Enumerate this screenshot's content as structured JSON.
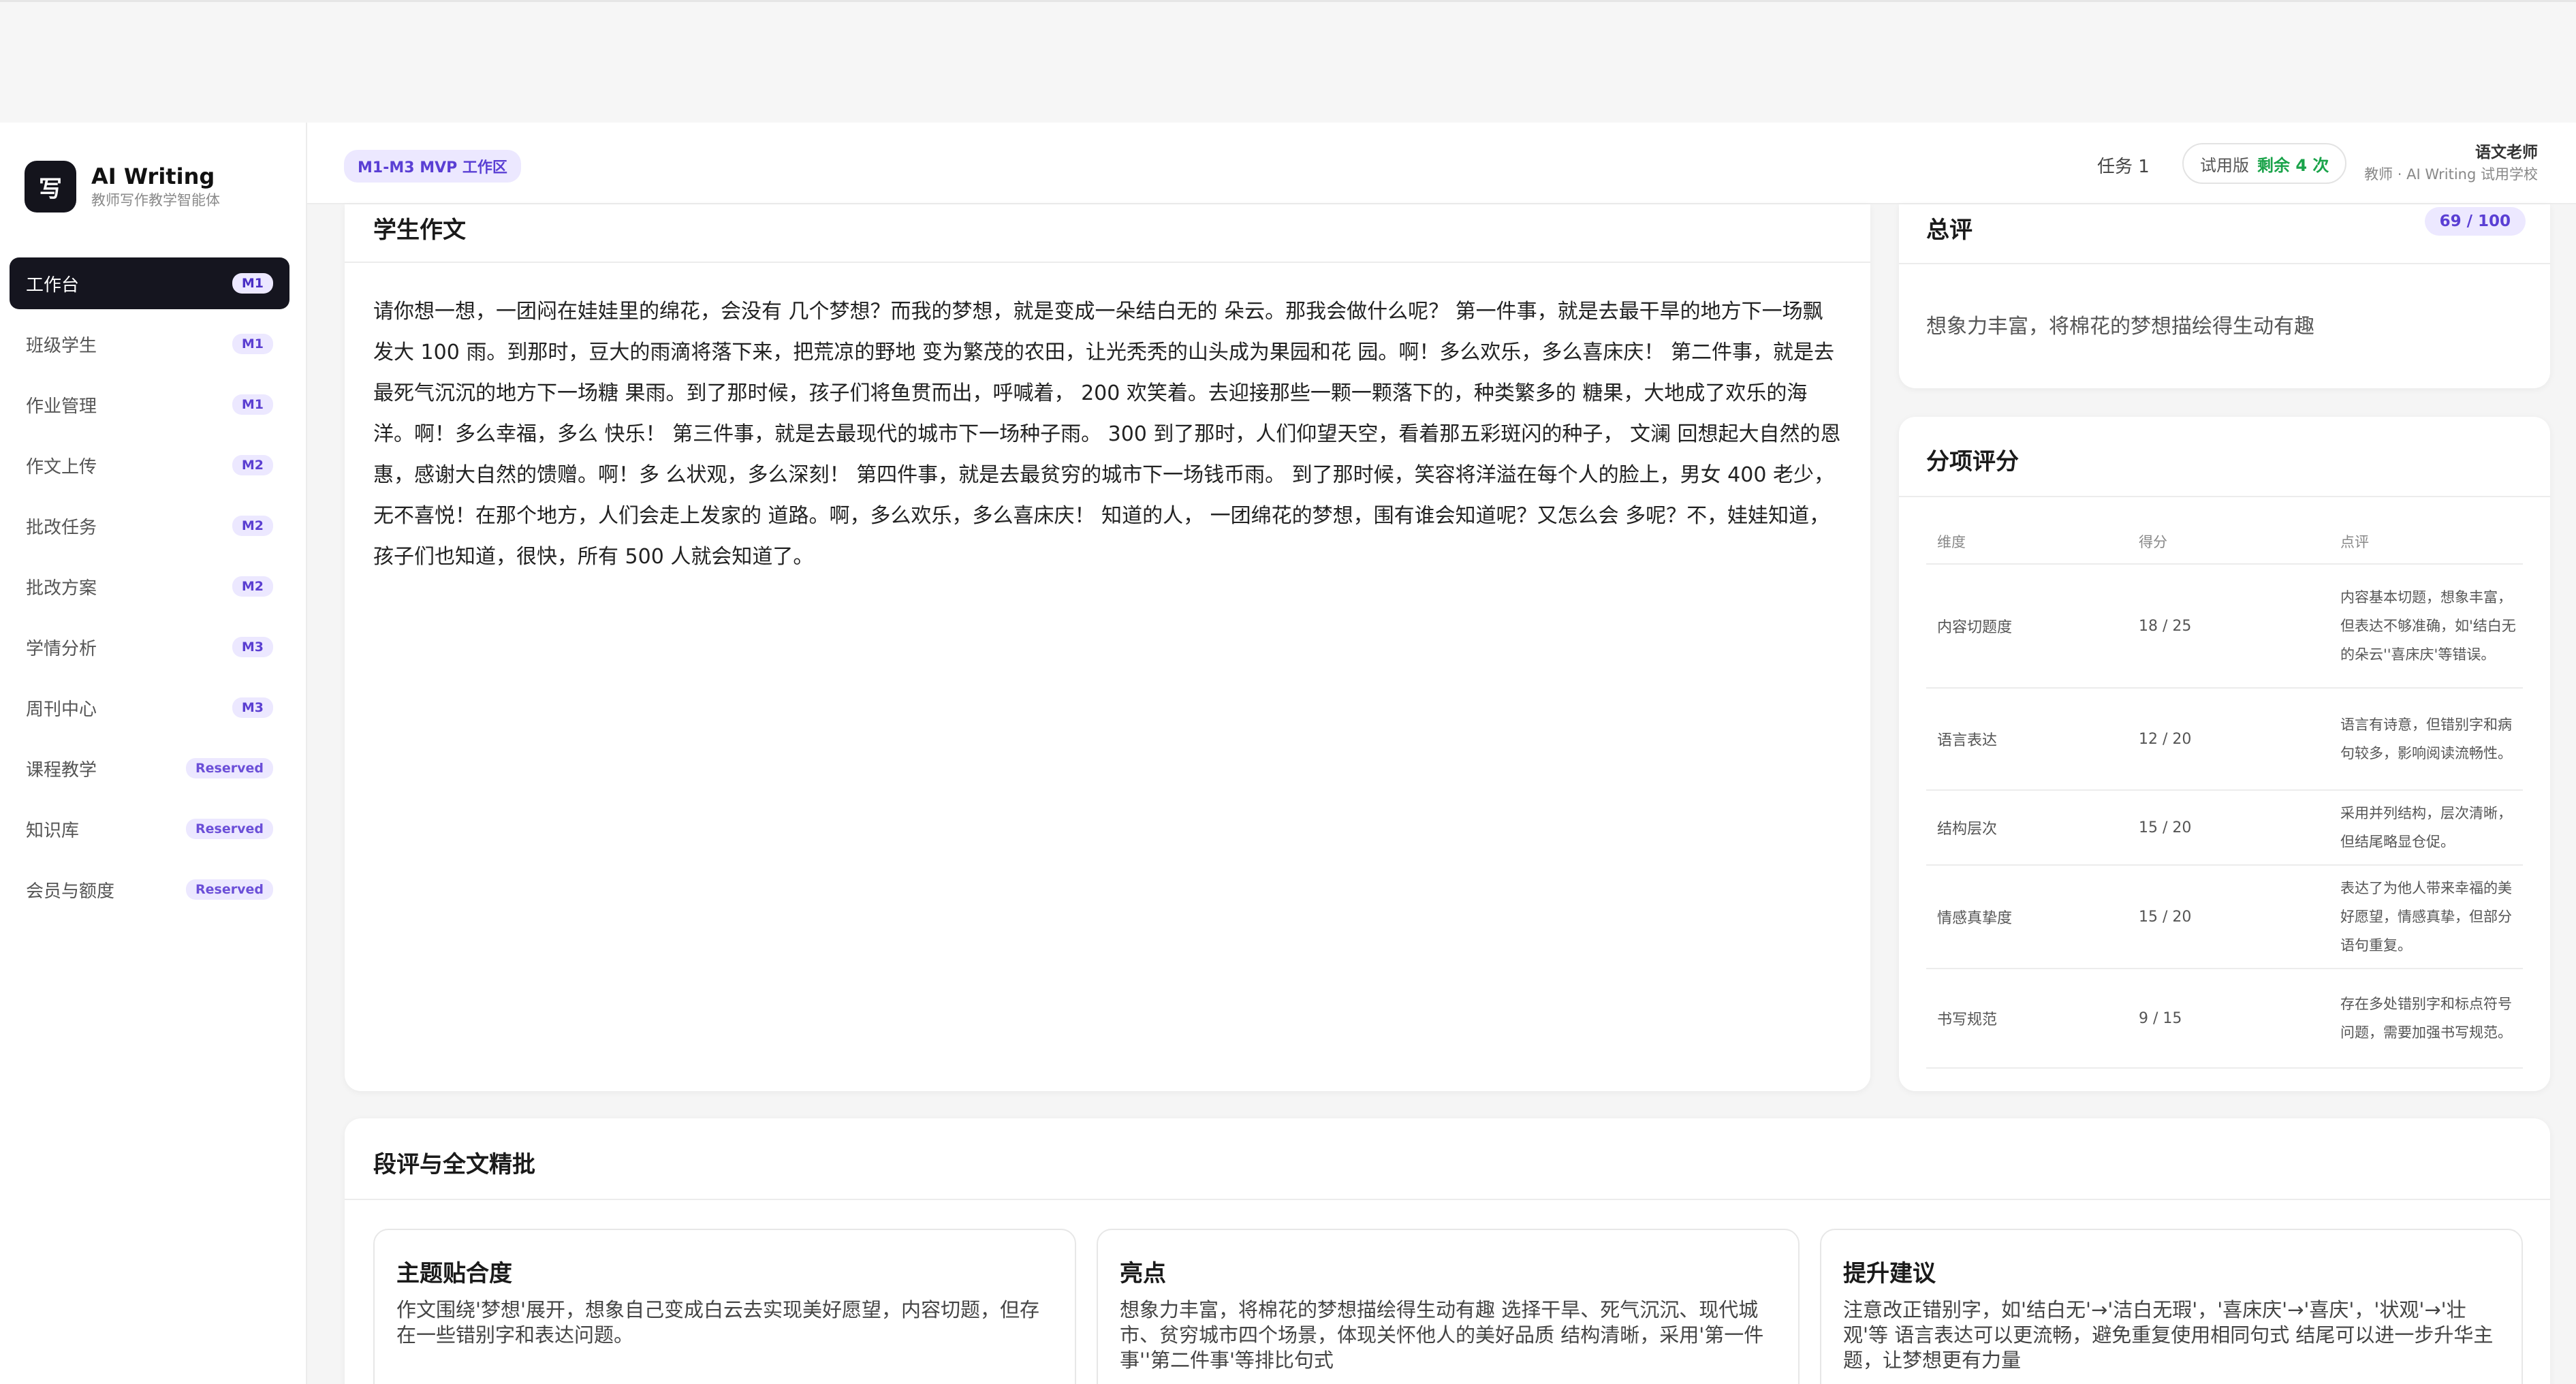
{
  "brand": {
    "logo": "写",
    "title": "AI Writing",
    "subtitle": "教师写作教学智能体"
  },
  "nav": [
    {
      "label": "工作台",
      "badge": "M1",
      "active": true
    },
    {
      "label": "班级学生",
      "badge": "M1"
    },
    {
      "label": "作业管理",
      "badge": "M1"
    },
    {
      "label": "作文上传",
      "badge": "M2"
    },
    {
      "label": "批改任务",
      "badge": "M2"
    },
    {
      "label": "批改方案",
      "badge": "M2"
    },
    {
      "label": "学情分析",
      "badge": "M3"
    },
    {
      "label": "周刊中心",
      "badge": "M3"
    },
    {
      "label": "课程教学",
      "badge": "Reserved"
    },
    {
      "label": "知识库",
      "badge": "Reserved"
    },
    {
      "label": "会员与额度",
      "badge": "Reserved"
    }
  ],
  "header": {
    "workspace_tag": "M1-M3 MVP 工作区",
    "task": "任务 1",
    "trial_label": "试用版",
    "trial_remaining": "剩余 4 次",
    "user_name": "语文老师",
    "user_role": "教师 · AI Writing 试用学校"
  },
  "essay": {
    "title": "学生作文",
    "text": "请你想一想，一团闷在娃娃里的绵花，会没有 几个梦想？而我的梦想，就是变成一朵结白无的 朵云。那我会做什么呢？ 第一件事，就是去最干旱的地方下一场飘发大 100 雨。到那时，豆大的雨滴将落下来，把荒凉的野地 变为繁茂的农田，让光秃秃的山头成为果园和花 园。啊！多么欢乐，多么喜床庆！ 第二件事，就是去最死气沉沉的地方下一场糖 果雨。到了那时候，孩子们将鱼贯而出，呼喊着， 200 欢笑着。去迎接那些一颗一颗落下的，种类繁多的 糖果，大地成了欢乐的海洋。啊！多么幸福，多么 快乐！ 第三件事，就是去最现代的城市下一场种子雨。 300 到了那时，人们仰望天空，看着那五彩斑闪的种子， 文澜 回想起大自然的恩惠，感谢大自然的馈赠。啊！多 么状观，多么深刻！ 第四件事，就是去最贫穷的城市下一场钱币雨。 到了那时候，笑容将洋溢在每个人的脸上，男女 400 老少，无不喜悦！在那个地方，人们会走上发家的 道路。啊，多么欢乐，多么喜床庆！ 知道的人， 一团绵花的梦想，围有谁会知道呢？又怎么会 多呢？不，娃娃知道，孩子们也知道，很快，所有 500 人就会知道了。"
  },
  "summary": {
    "title": "总评",
    "score": "69 / 100",
    "text": "想象力丰富，将棉花的梦想描绘得生动有趣"
  },
  "sub_scores": {
    "title": "分项评分",
    "headers": [
      "维度",
      "得分",
      "点评"
    ],
    "rows": [
      {
        "dim": "内容切题度",
        "score": "18 / 25",
        "comment": "内容基本切题，想象丰富，但表达不够准确，如'结白无的朵云''喜床庆'等错误。"
      },
      {
        "dim": "语言表达",
        "score": "12 / 20",
        "comment": "语言有诗意，但错别字和病句较多，影响阅读流畅性。"
      },
      {
        "dim": "结构层次",
        "score": "15 / 20",
        "comment": "采用并列结构，层次清晰，但结尾略显仓促。"
      },
      {
        "dim": "情感真挚度",
        "score": "15 / 20",
        "comment": "表达了为他人带来幸福的美好愿望，情感真挚，但部分语句重复。"
      },
      {
        "dim": "书写规范",
        "score": "9 / 15",
        "comment": "存在多处错别字和标点符号问题，需要加强书写规范。"
      }
    ]
  },
  "review": {
    "title": "段评与全文精批",
    "boxes": [
      {
        "title": "主题贴合度",
        "text": "作文围绕'梦想'展开，想象自己变成白云去实现美好愿望，内容切题，但存在一些错别字和表达问题。"
      },
      {
        "title": "亮点",
        "text": "想象力丰富，将棉花的梦想描绘得生动有趣 选择干旱、死气沉沉、现代城市、贫穷城市四个场景，体现关怀他人的美好品质 结构清晰，采用'第一件事''第二件事'等排比句式"
      },
      {
        "title": "提升建议",
        "text": "注意改正错别字，如'结白无'→'洁白无瑕'，'喜床庆'→'喜庆'，'状观'→'壮观'等 语言表达可以更流畅，避免重复使用相同句式 结尾可以进一步升华主题，让梦想更有力量"
      }
    ]
  }
}
